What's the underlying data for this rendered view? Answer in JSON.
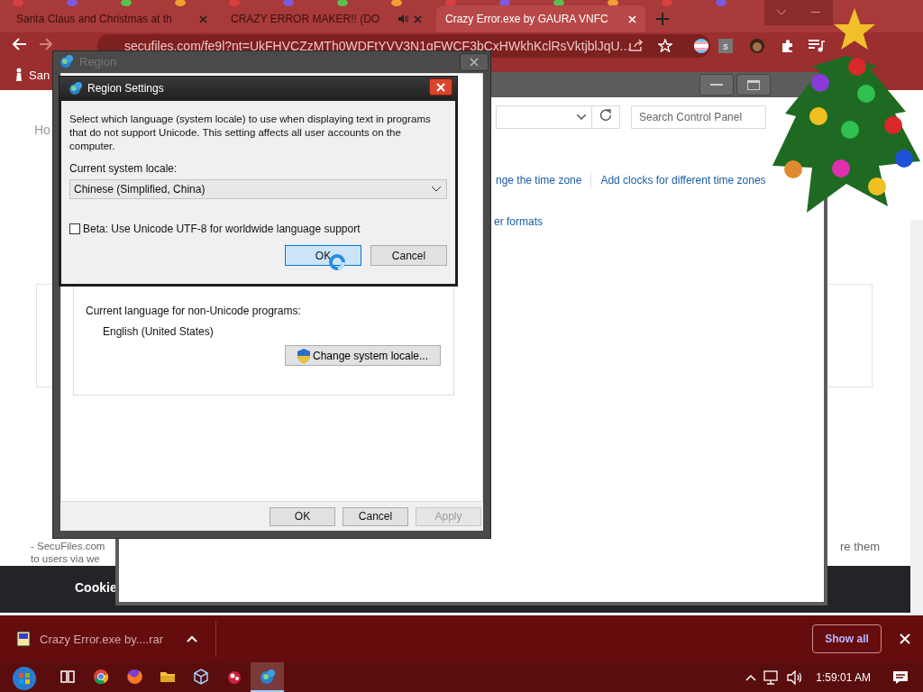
{
  "browser": {
    "tabs": [
      {
        "title": "Santa Claus and Christmas at th",
        "selected": false,
        "audio": false
      },
      {
        "title": "CRAZY ERROR MAKER!! (DO",
        "selected": false,
        "audio": true
      },
      {
        "title": "Crazy Error.exe by GAURA VNFC",
        "selected": true,
        "audio": false
      }
    ],
    "url": "secufiles.com/fe9l?nt=UkFHVCZzMTh0WDFtYVV3N1gFWCF3bCxHWkhKclRsVktjblJqU...",
    "extension_badge": "s",
    "bookmark": "San"
  },
  "page": {
    "breadcrumb": "Ho",
    "text_lines": [
      "- SecuFiles.com",
      "to users via we"
    ],
    "text_right": "re them",
    "cookie_text": "Cookie"
  },
  "control_panel": {
    "search": {
      "placeholder": "Search Control Panel"
    },
    "links": [
      "nge the time zone",
      "Add clocks for different time zones"
    ],
    "link_below": "er formats"
  },
  "region_window": {
    "title": "Region",
    "active": false,
    "group_label": "Current language for non-Unicode programs:",
    "current_language": "English (United States)",
    "change_button": "Change system locale...",
    "buttons": [
      {
        "label": "OK",
        "disabled": false
      },
      {
        "label": "Cancel",
        "disabled": false
      },
      {
        "label": "Apply",
        "disabled": true
      }
    ]
  },
  "region_settings": {
    "title": "Region Settings",
    "active": true,
    "description": "Select which language (system locale) to use when displaying text in programs that do not support Unicode. This setting affects all user accounts on the computer.",
    "locale_label": "Current system locale:",
    "locale": {
      "value": "Chinese (Simplified, China)"
    },
    "beta": {
      "label": "Beta: Use Unicode UTF-8 for worldwide language support",
      "checked": false
    },
    "buttons": [
      {
        "label": "OK",
        "focused": true
      },
      {
        "label": "Cancel",
        "focused": false
      }
    ]
  },
  "downloads": {
    "file": "Crazy Error.exe by....rar",
    "show_all": "Show all"
  },
  "taskbar": {
    "apps": [
      {
        "kind": "task-view",
        "selected": false
      },
      {
        "kind": "chrome",
        "selected": false
      },
      {
        "kind": "firefox",
        "selected": false
      },
      {
        "kind": "folder",
        "selected": false
      },
      {
        "kind": "cube",
        "selected": false
      },
      {
        "kind": "game",
        "selected": false
      },
      {
        "kind": "region",
        "selected": true
      }
    ],
    "clock": "1:59:01 AM"
  }
}
